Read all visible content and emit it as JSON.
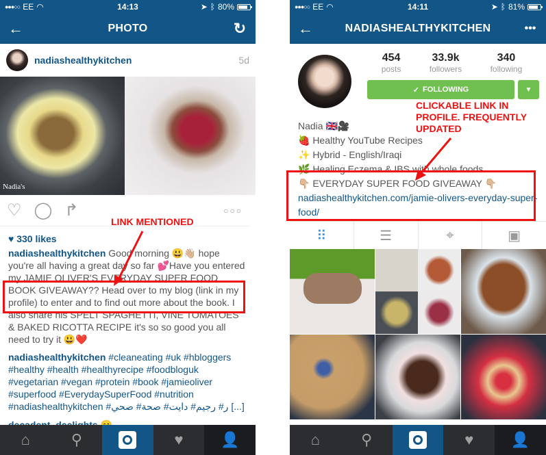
{
  "left": {
    "status": {
      "carrier": "EE",
      "time": "14:13",
      "battery": "80%",
      "battery_level": 0.8
    },
    "nav": {
      "back_icon": "arrow-left",
      "title": "PHOTO",
      "refresh_icon": "refresh"
    },
    "post": {
      "username": "nadiashealthykitchen",
      "age": "5d",
      "watermark": "Nadia's",
      "likes": "330 likes",
      "caption_user": "nadiashealthykitchen",
      "caption_text": "Good morning 😃👋🏼 hope you're all having a great day so far 💕Have you entered my JAMIE OLIVER'S EVERYDAY SUPER FOOD BOOK GIVEAWAY?? Head over to my blog (link in my profile) to enter and to find out more about the book. I also share his SPELT SPAGHETTI, VINE TOMATOES & BAKED RICOTTA RECIPE it's so so good you all need to try it 😃❤️",
      "hashtags_user": "nadiashealthykitchen",
      "hashtags": "#cleaneating #uk #hbloggers #healthy #health #healthyrecipe #foodbloguk #vegetarian #vegan #protein #book #jamieoliver #superfood #EverydaySuperFood #nutrition #nadiashealthykitchen #ر# رجيم# دايت# صحة# صحي [...]",
      "comment_user": "decadent_deelights",
      "comment_emoji": "😄"
    },
    "annotation": "LINK MENTIONED"
  },
  "right": {
    "status": {
      "carrier": "EE",
      "time": "14:11",
      "battery": "81%",
      "battery_level": 0.81
    },
    "nav": {
      "back_icon": "arrow-left",
      "title": "NADIASHEALTHYKITCHEN",
      "more_icon": "more-dots"
    },
    "profile": {
      "stats": [
        {
          "value": "454",
          "label": "posts"
        },
        {
          "value": "33.9k",
          "label": "followers"
        },
        {
          "value": "340",
          "label": "following"
        }
      ],
      "follow_label": "FOLLOWING",
      "name": "Nadia 🇬🇧🎥",
      "bio_lines": [
        "🍓 Healthy YouTube Recipes",
        "✨ Hybrid - English/Iraqi",
        "🌿 Healing Eczema & IBS with whole foods",
        "👇🏼 EVERYDAY SUPER FOOD GIVEAWAY 👇🏼"
      ],
      "link": "nadiashealthykitchen.com/jamie-olivers-everyday-super-food/"
    },
    "annotation": "CLICKABLE LINK IN PROFILE. FREQUENTLY UPDATED",
    "view_tabs": [
      "grid",
      "list",
      "location",
      "tagged"
    ]
  },
  "tabbar": [
    "home",
    "search",
    "camera",
    "activity",
    "profile"
  ],
  "colors": {
    "brand": "#125688",
    "follow_green": "#70c050",
    "annotation_red": "#ee1111"
  }
}
